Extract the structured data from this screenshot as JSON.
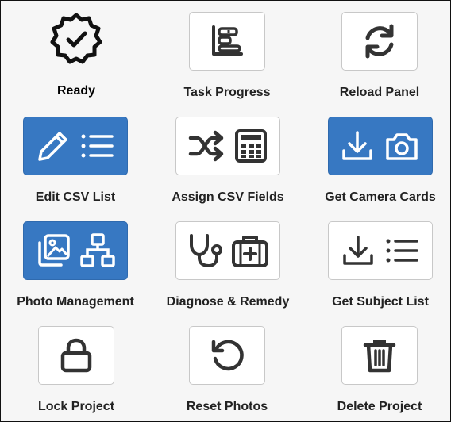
{
  "panel": {
    "tiles": [
      {
        "label": "Ready",
        "icon": "badge-check-icon"
      },
      {
        "label": "Task Progress",
        "icon": "bar-chart-icon"
      },
      {
        "label": "Reload Panel",
        "icon": "refresh-icon"
      },
      {
        "label": "Edit CSV List",
        "icon": "pencil-list-icon"
      },
      {
        "label": "Assign CSV Fields",
        "icon": "shuffle-calculator-icon"
      },
      {
        "label": "Get Camera Cards",
        "icon": "download-camera-icon"
      },
      {
        "label": "Photo Management",
        "icon": "images-sitemap-icon"
      },
      {
        "label": "Diagnose & Remedy",
        "icon": "stethoscope-medkit-icon"
      },
      {
        "label": "Get Subject List",
        "icon": "download-list-icon"
      },
      {
        "label": "Lock Project",
        "icon": "lock-icon"
      },
      {
        "label": "Reset Photos",
        "icon": "undo-icon"
      },
      {
        "label": "Delete Project",
        "icon": "trash-icon"
      }
    ]
  },
  "colors": {
    "accent_blue": "#3778c2",
    "icon_dark": "#333333",
    "icon_light": "#ffffff"
  }
}
